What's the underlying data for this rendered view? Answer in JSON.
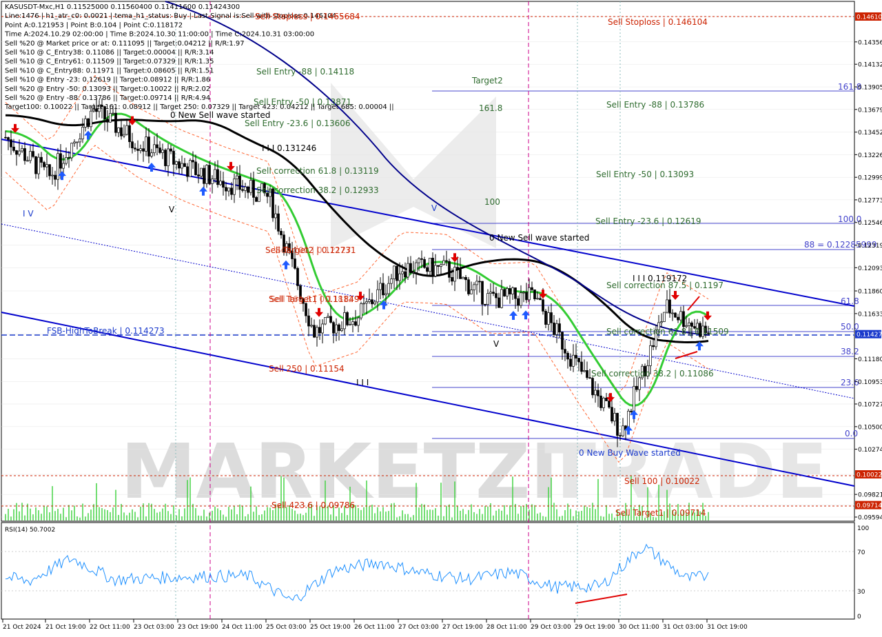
{
  "colors": {
    "background": "#ffffff",
    "grid": "#e5e5e5",
    "candle": "#000000",
    "ma_black": "#000000",
    "ma_green": "#33cc33",
    "ma_blue": "#00008b",
    "channel_blue": "#0000cc",
    "bullish_arrow": "#1e5aff",
    "bearish_arrow": "#e00000",
    "sell_text": "#cc2200",
    "entry_text": "#2e6b2e",
    "volume": "#44d244",
    "rsi_line": "#1e90ff",
    "price_tag_red": "#cc2200",
    "price_tag_blue": "#1a3acc",
    "watermark": "#d9d9d9"
  },
  "info_lines": [
    "KASUSDT-Mxc,H1  0.11525000 0.11560400 0.11411600 0.11424300",
    "Line:1476 | h1_atr_c0: 0.0021 | tema_h1_status: Buy | Last Signal is:Sell with stoploss:0.146104",
    "Point A:0.121953 | Point B:0.104 | Point C:0.118172",
    "Time A:2024.10.29 02:00:00 | Time B:2024.10.30 11:00:00 | Time C:2024.10.31 03:00:00",
    "Sell %20 @ Market price or at: 0.111095 || Target:0.04212 || R/R:1.97",
    "Sell %10 @ C_Entry38: 0.11086 || Target:0.00004 || R/R:3.14",
    "Sell %10 @ C_Entry61: 0.11509 || Target:0.07329 || R/R:1.35",
    "Sell %10 @ C_Entry88: 0.11971 || Target:0.08605 || R/R:1.51",
    "Sell %10 @ Entry -23: 0.12619 || Target:0.08912 || R/R:1.86",
    "Sell %20 @ Entry -50: 0.13093 || Target:0.10022 || R/R:2.02",
    "Sell %20 @ Entry -88: 0.13786 || Target:0.09714 || R/R:4.94",
    "Target100: 0.10022 || Target 161: 0.08912 || Target 250: 0.07329 || Target 423: 0.04212 || Target 685: 0.00004 ||"
  ],
  "annotations": {
    "stoploss_left": "Sell Stoploss | 0.1465684",
    "stoploss_right": "Sell Stoploss | 0.146104",
    "entry_88_left": "Sell Entry -88 | 0.14118",
    "entry_50_left": "Sell Entry -50 | 0.13871",
    "entry_23_left": "Sell Entry -23.6 | 0.13606",
    "new_sell_wave_left": "0 New Sell wave started",
    "wave_iii_value": "I I I 0.131246",
    "sell_corr_61_left": "Sell correction 61.8 | 0.13119",
    "sell_corr_38_left": "Sell correction 38.2 | 0.12933",
    "sell_target_left": "Sell Target2 | 0.12731",
    "sell_100_left": "Sell 100 | 0.12127",
    "sell_target1_left": "Sell Target1 | 0.11849",
    "sell_161_left": "Sell 161.8 | 0.11812",
    "sell_250": "Sell 250 | 0.11154",
    "sell_4236": "Sell 423.6 | 0.09786",
    "fsb_high": "FSB-HighToBreak | 0.114273",
    "target2": "Target2",
    "fib_1618_mid": "161.8",
    "fib_100_mid": "100",
    "entry_88_right": "Sell Entry -88 | 0.13786",
    "entry_50_right": "Sell Entry -50 | 0.13093",
    "entry_23_right": "Sell Entry -23.6 | 0.12619",
    "new_sell_wave_right": "0 New Sell wave started",
    "wave_i_right": "I I I 0.119172",
    "sell_corr_875": "Sell correction 87.5 | 0.1197",
    "sell_corr_618": "Sell correction 61.8 | 0.11509",
    "sell_corr_382": "Sell correction 38.2 | 0.11086",
    "new_buy_wave": "0 New Buy Wave started",
    "sell_100_right": "Sell 100 | 0.10022",
    "sell_target1_right": "Sell Target1 | 0.09714",
    "wave_iv": "I V",
    "wave_v1": "V",
    "wave_v2": "V",
    "wave_iii_low": "I I I",
    "wave_v3": "V",
    "fib_1618_right": "161.8",
    "fib_100_right": "100.0",
    "fib_88_right": "88 = 0.12285999",
    "fib_618_right": "61.8",
    "fib_500_right": "50.0",
    "fib_382_right": "38.2",
    "fib_236_right": "23.6",
    "fib_00_right": "0.0"
  },
  "watermark": {
    "brand_main": "MARKETZI",
    "brand_trade": "TRADE"
  },
  "price_axis": [
    {
      "label": "0.14610",
      "value": 0.1461,
      "tag": "red"
    },
    {
      "label": "0.14356",
      "value": 0.14356
    },
    {
      "label": "0.14132",
      "value": 0.14132
    },
    {
      "label": "0.13905",
      "value": 0.13905
    },
    {
      "label": "0.13679",
      "value": 0.13679
    },
    {
      "label": "0.13452",
      "value": 0.13452
    },
    {
      "label": "0.13226",
      "value": 0.13226
    },
    {
      "label": "0.12999",
      "value": 0.12999
    },
    {
      "label": "0.12773",
      "value": 0.12773
    },
    {
      "label": "0.12546",
      "value": 0.12546
    },
    {
      "label": "0.12319",
      "value": 0.12319
    },
    {
      "label": "0.12093",
      "value": 0.12093
    },
    {
      "label": "0.11860",
      "value": 0.1186
    },
    {
      "label": "0.11633",
      "value": 0.11633
    },
    {
      "label": "0.11427",
      "value": 0.11427,
      "tag": "blue"
    },
    {
      "label": "0.11180",
      "value": 0.1118
    },
    {
      "label": "0.10953",
      "value": 0.10953
    },
    {
      "label": "0.10727",
      "value": 0.10727
    },
    {
      "label": "0.10500",
      "value": 0.105
    },
    {
      "label": "0.10274",
      "value": 0.10274
    },
    {
      "label": "0.10022",
      "value": 0.10022,
      "tag": "red"
    },
    {
      "label": "0.09821",
      "value": 0.09821
    },
    {
      "label": "0.09714",
      "value": 0.09714,
      "tag": "red"
    },
    {
      "label": "0.09594",
      "value": 0.09594
    }
  ],
  "time_axis": [
    "21 Oct 2024",
    "21 Oct 19:00",
    "22 Oct 11:00",
    "23 Oct 03:00",
    "23 Oct 19:00",
    "24 Oct 11:00",
    "25 Oct 03:00",
    "25 Oct 19:00",
    "26 Oct 11:00",
    "27 Oct 03:00",
    "27 Oct 19:00",
    "28 Oct 11:00",
    "29 Oct 03:00",
    "29 Oct 19:00",
    "30 Oct 11:00",
    "31 Oct 03:00",
    "31 Oct 19:00"
  ],
  "rsi": {
    "label": "RSI(14) 50.7002",
    "current": 50.7002,
    "ticks": [
      "100",
      "70",
      "30",
      "0"
    ]
  },
  "chart_data": {
    "type": "candlestick",
    "title": "KASUSDT-Mxc,H1",
    "timeframe": "H1",
    "ohlc_last": {
      "open": 0.11525,
      "high": 0.115604,
      "low": 0.114116,
      "close": 0.114243
    },
    "ylim": [
      0.0955,
      0.147
    ],
    "key_points": [
      {
        "time": "21 Oct 2024",
        "price": 0.134
      },
      {
        "time": "21 Oct 19:00",
        "price": 0.13
      },
      {
        "time": "22 Oct 11:00",
        "price": 0.1368
      },
      {
        "time": "23 Oct 03:00",
        "price": 0.1335
      },
      {
        "time": "23 Oct 19:00",
        "price": 0.1312
      },
      {
        "time": "24 Oct 11:00",
        "price": 0.1295
      },
      {
        "time": "25 Oct 03:00",
        "price": 0.128
      },
      {
        "time": "25 Oct 19:00",
        "price": 0.1145
      },
      {
        "time": "26 Oct 11:00",
        "price": 0.116
      },
      {
        "time": "27 Oct 03:00",
        "price": 0.121
      },
      {
        "time": "27 Oct 19:00",
        "price": 0.1208
      },
      {
        "time": "28 Oct 11:00",
        "price": 0.1178
      },
      {
        "time": "29 Oct 03:00",
        "price": 0.118
      },
      {
        "time": "29 Oct 19:00",
        "price": 0.111
      },
      {
        "time": "30 Oct 11:00",
        "price": 0.1045
      },
      {
        "time": "31 Oct 03:00",
        "price": 0.117
      },
      {
        "time": "31 Oct 19:00",
        "price": 0.1142
      }
    ],
    "levels": [
      {
        "name": "Sell Stoploss",
        "value": 0.146104
      },
      {
        "name": "Sell Entry -88",
        "value": 0.13786
      },
      {
        "name": "Sell Entry -50",
        "value": 0.13093
      },
      {
        "name": "Sell Entry -23.6",
        "value": 0.12619
      },
      {
        "name": "FSB-HighToBreak",
        "value": 0.114273
      },
      {
        "name": "Sell 100",
        "value": 0.10022
      },
      {
        "name": "Sell Target1",
        "value": 0.09714
      }
    ],
    "rsi_last": 50.7002
  }
}
